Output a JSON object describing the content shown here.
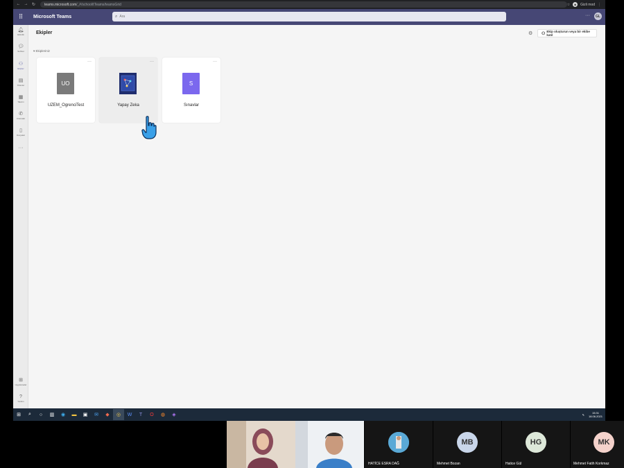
{
  "browser": {
    "url_host": "teams.microsoft.com",
    "url_path": "/_#/school/tTeams/teamsGrid",
    "profile_label": "Gizli mod"
  },
  "header": {
    "app_title": "Microsoft Teams",
    "search_placeholder": "Ara",
    "avatar_initials": "GL",
    "accent": "#464775"
  },
  "rail": [
    {
      "label": "Etkinlik",
      "icon": "bell-icon"
    },
    {
      "label": "Sohbet",
      "icon": "chat-icon"
    },
    {
      "label": "Ekipler",
      "icon": "teams-icon"
    },
    {
      "label": "Ödevler",
      "icon": "assignments-icon"
    },
    {
      "label": "Takvim",
      "icon": "calendar-icon"
    },
    {
      "label": "Aramalar",
      "icon": "phone-icon"
    },
    {
      "label": "Dosyalar",
      "icon": "files-icon"
    },
    {
      "label": "Uygulamalar",
      "icon": "apps-icon"
    },
    {
      "label": "Yardım",
      "icon": "help-icon"
    }
  ],
  "main": {
    "title": "Ekipler",
    "join_create_label": "Ekip oluşturun veya bir ekibe katıl",
    "section_label": "Ekipleriniz",
    "teams": [
      {
        "name": "UZEM_OgrenciTest",
        "tile_text": "UO",
        "color": "#7a7a7a"
      },
      {
        "name": "Yapay Zeka",
        "tile_text": "",
        "color": "#2b3a8c"
      },
      {
        "name": "Sınavlar",
        "tile_text": "S",
        "color": "#7b68ee"
      }
    ]
  },
  "taskbar": {
    "time": "15:31",
    "date": "18.06.2021"
  },
  "participants": [
    {
      "name": "HATİCE ESRA  DAĞ",
      "initials": "",
      "color": "#5aa9d6"
    },
    {
      "name": "Mehmet Bozan",
      "initials": "MB",
      "color": "#c9d6ea"
    },
    {
      "name": "Hatice Gül",
      "initials": "HG",
      "color": "#dde8d9"
    },
    {
      "name": "Mehmet Fatih Korkmaz",
      "initials": "MK",
      "color": "#f4d2cb"
    }
  ]
}
